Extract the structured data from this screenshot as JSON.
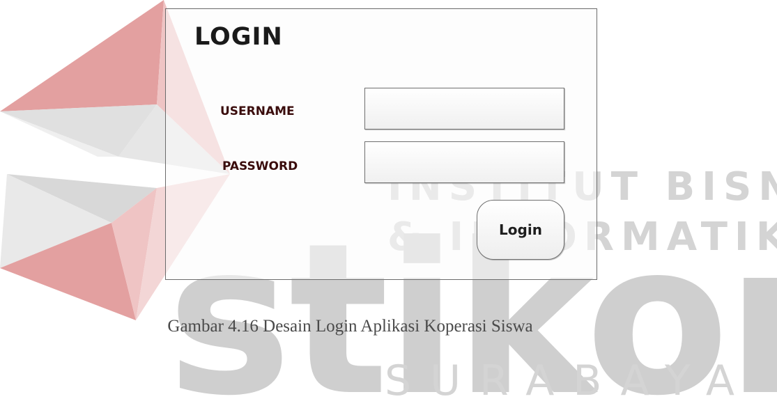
{
  "watermark": {
    "line1": "INSTITUT BISNIS",
    "line2": "& INFORMATIKA",
    "brand": "stikom",
    "city": "SURABAYA",
    "colors": {
      "red": "#e2a3a3",
      "gray": "#d6d6d6"
    }
  },
  "login_form": {
    "title": "LOGIN",
    "username_label": "USERNAME",
    "password_label": "PASSWORD",
    "username_value": "",
    "password_value": "",
    "button_label": "Login"
  },
  "caption": "Gambar 4.16 Desain Login Aplikasi Koperasi Siswa"
}
